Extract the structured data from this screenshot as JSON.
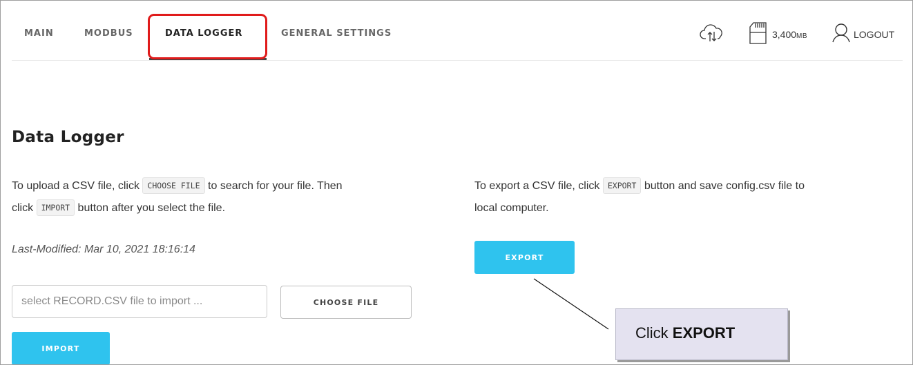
{
  "nav": {
    "tabs": [
      {
        "label": "MAIN",
        "active": false
      },
      {
        "label": "MODBUS",
        "active": false
      },
      {
        "label": "DATA LOGGER",
        "active": true
      },
      {
        "label": "GENERAL SETTINGS",
        "active": false
      }
    ],
    "storage_value": "3,400",
    "storage_unit": "MB",
    "logout_label": "LOGOUT",
    "icons": [
      "cloud-sync-icon",
      "sd-card-icon",
      "user-icon"
    ]
  },
  "page": {
    "title": "Data Logger",
    "import_text": {
      "line1_before": "To upload a CSV file, click ",
      "line1_code": "CHOOSE FILE",
      "line1_after": " to search for your file. Then",
      "line2_before": "click ",
      "line2_code": "IMPORT",
      "line2_after": " button after you select the file."
    },
    "export_text": {
      "line1_before": "To export a CSV file, click ",
      "line1_code": "EXPORT",
      "line1_after": " button and save config.csv file to",
      "line2": "local computer."
    },
    "last_modified": "Last-Modified: Mar 10, 2021 18:16:14",
    "file_input_placeholder": "select RECORD.CSV file to import ...",
    "choose_file_label": "CHOOSE FILE",
    "import_label": "IMPORT",
    "export_label": "EXPORT"
  },
  "annotation": {
    "callout_prefix": "Click ",
    "callout_bold": "EXPORT"
  },
  "colors": {
    "accent": "#2fc3ee",
    "highlight": "#e01b1b",
    "callout_bg": "#e4e2f0"
  }
}
